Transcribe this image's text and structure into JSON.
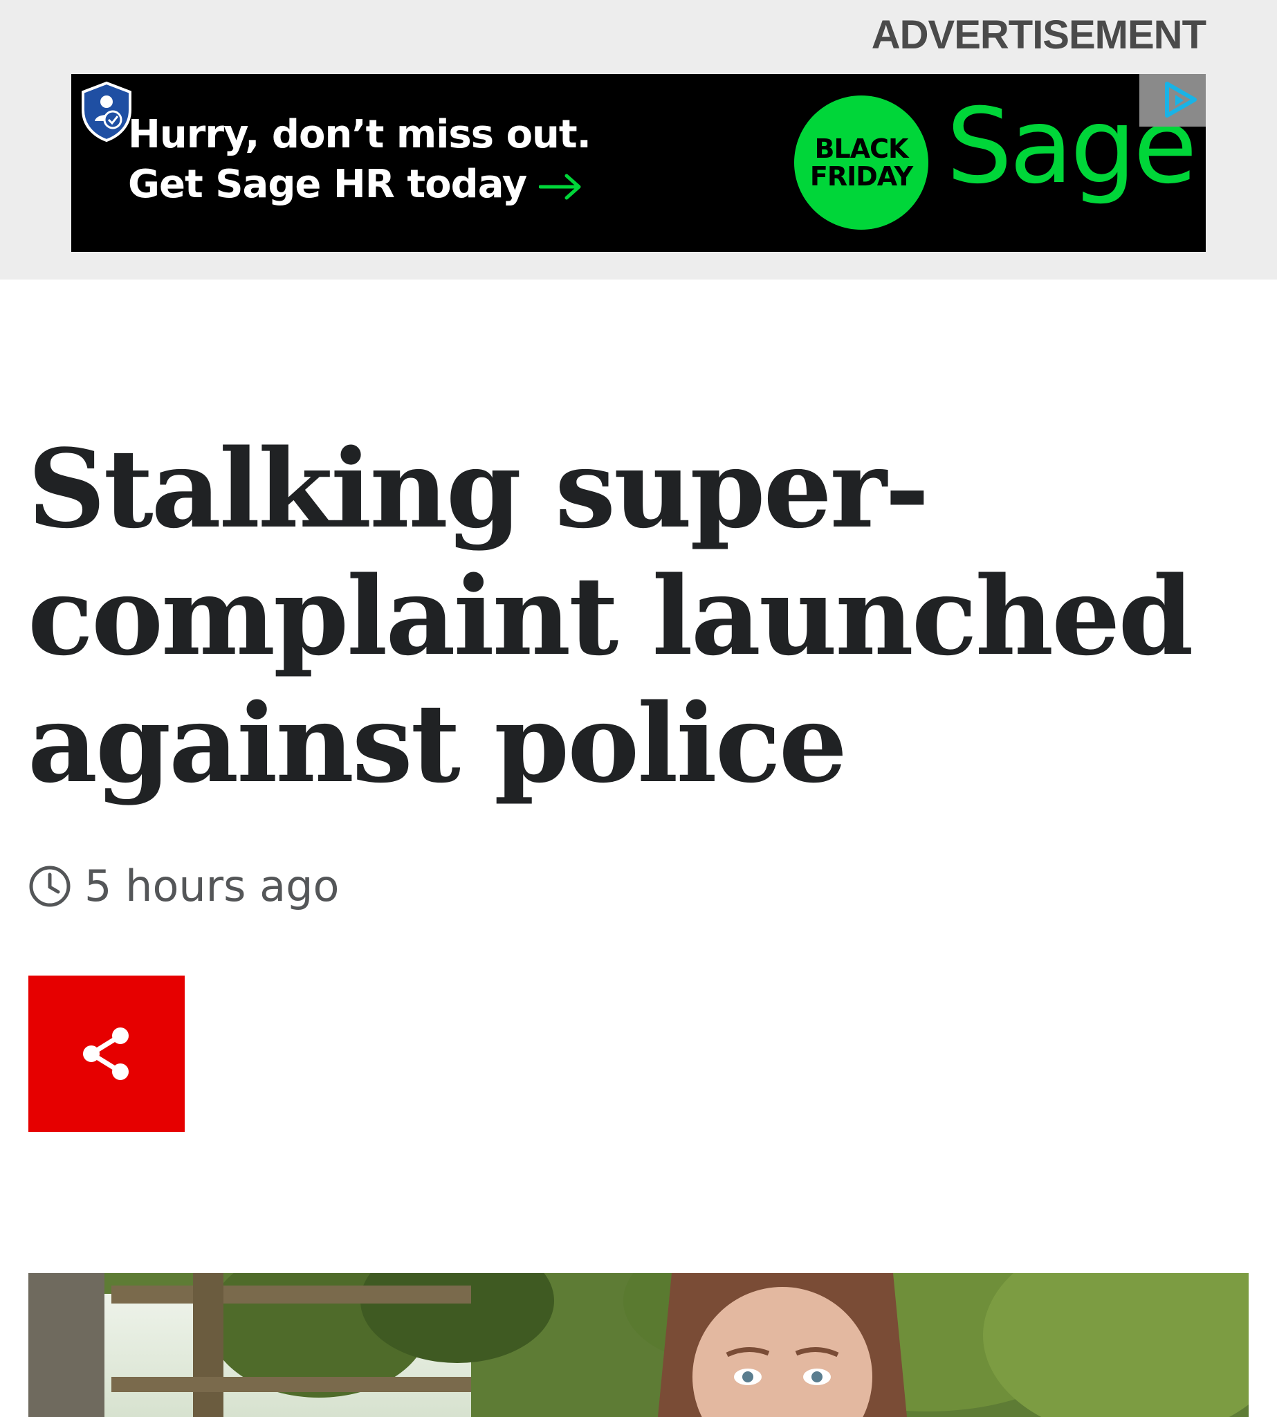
{
  "advertisement": {
    "label": "ADVERTISEMENT",
    "line1": "Hurry, don’t miss out.",
    "line2": "Get Sage HR today",
    "badge_line1": "BLACK",
    "badge_line2": "FRIDAY",
    "brand": "Sage",
    "brand_color": "#00d639",
    "icons": [
      "shield-icon",
      "arrow-right-icon",
      "ad-choices-icon"
    ]
  },
  "article": {
    "headline": "Stalking super-complaint launched against police",
    "timestamp": "5 hours ago",
    "accent_color": "#e60000",
    "icons": [
      "clock-icon",
      "share-icon"
    ]
  }
}
